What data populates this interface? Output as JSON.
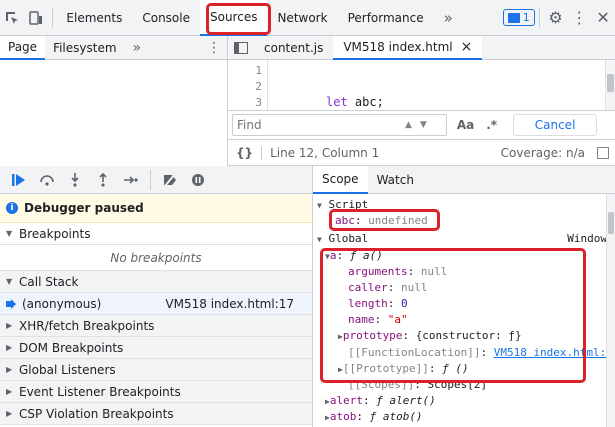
{
  "topbar": {
    "tabs": [
      "Elements",
      "Console",
      "Sources",
      "Network",
      "Performance"
    ],
    "more": "»",
    "issues_count": "1"
  },
  "navigator": {
    "tabs": [
      "Page",
      "Filesystem"
    ],
    "more": "»"
  },
  "editor": {
    "tabs": [
      {
        "label": "content.js"
      },
      {
        "label": "VM518 index.html",
        "close": "×"
      }
    ],
    "line_numbers": [
      "1",
      "2",
      "3"
    ],
    "code_keyword": "let",
    "code_rest": " abc;"
  },
  "find": {
    "placeholder": "Find",
    "match_case": "Aa",
    "regex": ".*",
    "cancel": "Cancel"
  },
  "status": {
    "braces": "{}",
    "position": "Line 12, Column 1",
    "coverage": "Coverage: n/a"
  },
  "debugger": {
    "paused": "Debugger paused",
    "breakpoints": "Breakpoints",
    "no_breakpoints": "No breakpoints",
    "call_stack": "Call Stack",
    "frame_name": "(anonymous)",
    "frame_location": "VM518 index.html:17",
    "sections": [
      "XHR/fetch Breakpoints",
      "DOM Breakpoints",
      "Global Listeners",
      "Event Listener Breakpoints",
      "CSP Violation Breakpoints"
    ]
  },
  "scope": {
    "tabs": [
      "Scope",
      "Watch"
    ],
    "script_label": "Script",
    "abc_key": "abc",
    "abc_value": "undefined",
    "global_label": "Global",
    "global_value": "Window",
    "a_key": "a",
    "a_value": "ƒ a()",
    "props": [
      {
        "key": "arguments",
        "value": "null"
      },
      {
        "key": "caller",
        "value": "null"
      },
      {
        "key": "length",
        "value": "0"
      },
      {
        "key": "name",
        "value": "\"a\""
      }
    ],
    "prototype_key": "prototype",
    "prototype_value": "{constructor: ƒ}",
    "fnloc_key": "[[FunctionLocation]]",
    "fnloc_value": "VM518 index.html:",
    "proto_key": "[[Prototype]]",
    "proto_value": "ƒ ()",
    "scopes_key": "[[Scopes]]",
    "scopes_value": "Scopes[2]",
    "alert_key": "alert",
    "alert_value": "ƒ alert()",
    "atob_key": "atob",
    "atob_value": "ƒ atob()"
  }
}
